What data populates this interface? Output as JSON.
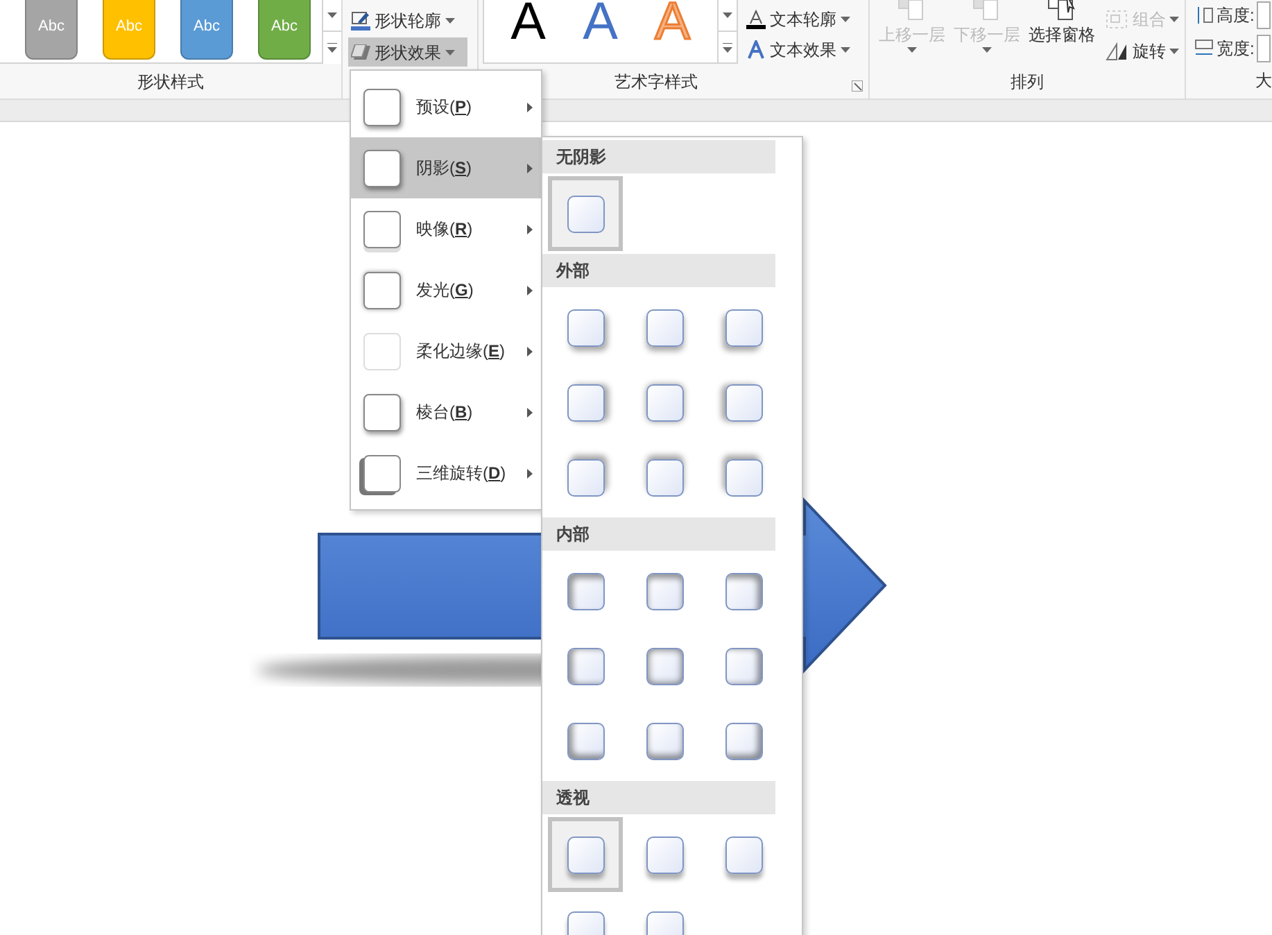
{
  "ribbon": {
    "shape_styles": {
      "swatches": [
        {
          "label": "Abc",
          "color": "#a5a5a5"
        },
        {
          "label": "Abc",
          "color": "#ffc000"
        },
        {
          "label": "Abc",
          "color": "#5b9bd5"
        },
        {
          "label": "Abc",
          "color": "#70ad47"
        }
      ],
      "group_label": "形状样式"
    },
    "shape_buttons": [
      {
        "label": "形状轮廓",
        "kind": "outline",
        "selected": false
      },
      {
        "label": "形状效果",
        "kind": "effects",
        "selected": true
      }
    ],
    "wordart": {
      "letters": [
        {
          "label": "A",
          "kind": "black"
        },
        {
          "label": "A",
          "kind": "blue"
        },
        {
          "label": "A",
          "kind": "orange"
        }
      ],
      "buttons": [
        {
          "label": "文本轮廓",
          "kind": "outline"
        },
        {
          "label": "文本效果",
          "kind": "effects"
        }
      ],
      "group_label": "艺术字样式"
    },
    "arrange": {
      "buttons": [
        {
          "label": "上移一层",
          "disabled": true
        },
        {
          "label": "下移一层",
          "disabled": true
        },
        {
          "label": "选择窗格",
          "disabled": false
        }
      ],
      "small_buttons": [
        {
          "label": "组合",
          "disabled": true
        },
        {
          "label": "旋转",
          "disabled": false
        }
      ],
      "group_label": "排列"
    },
    "size": {
      "fields": [
        {
          "label": "高度:"
        },
        {
          "label": "宽度:"
        }
      ],
      "group_label": "大"
    }
  },
  "effects_menu": [
    {
      "label": "预设(**P**)",
      "selected": false
    },
    {
      "label": "阴影(**S**)",
      "selected": true
    },
    {
      "label": "映像(**R**)",
      "selected": false
    },
    {
      "label": "发光(**G**)",
      "selected": false
    },
    {
      "label": "柔化边缘(**E**)",
      "selected": false
    },
    {
      "label": "棱台(**B**)",
      "selected": false
    },
    {
      "label": "三维旋转(**D**)",
      "selected": false
    }
  ],
  "shadow_submenu": {
    "sections": [
      {
        "title": "无阴影",
        "tiles": [
          {
            "selected": true
          }
        ]
      },
      {
        "title": "外部",
        "tiles": [
          {
            "selected": false
          },
          {
            "selected": false
          },
          {
            "selected": false
          },
          {
            "selected": false
          },
          {
            "selected": false
          },
          {
            "selected": false
          },
          {
            "selected": false
          },
          {
            "selected": false
          },
          {
            "selected": false
          }
        ]
      },
      {
        "title": "内部",
        "tiles": [
          {
            "selected": false
          },
          {
            "selected": false
          },
          {
            "selected": false
          },
          {
            "selected": false
          },
          {
            "selected": false
          },
          {
            "selected": false
          },
          {
            "selected": false
          },
          {
            "selected": false
          },
          {
            "selected": false
          }
        ]
      },
      {
        "title": "透视",
        "tiles": [
          {
            "selected": true
          },
          {
            "selected": false
          },
          {
            "selected": false
          },
          {
            "selected": false
          },
          {
            "selected": false
          }
        ]
      }
    ]
  }
}
